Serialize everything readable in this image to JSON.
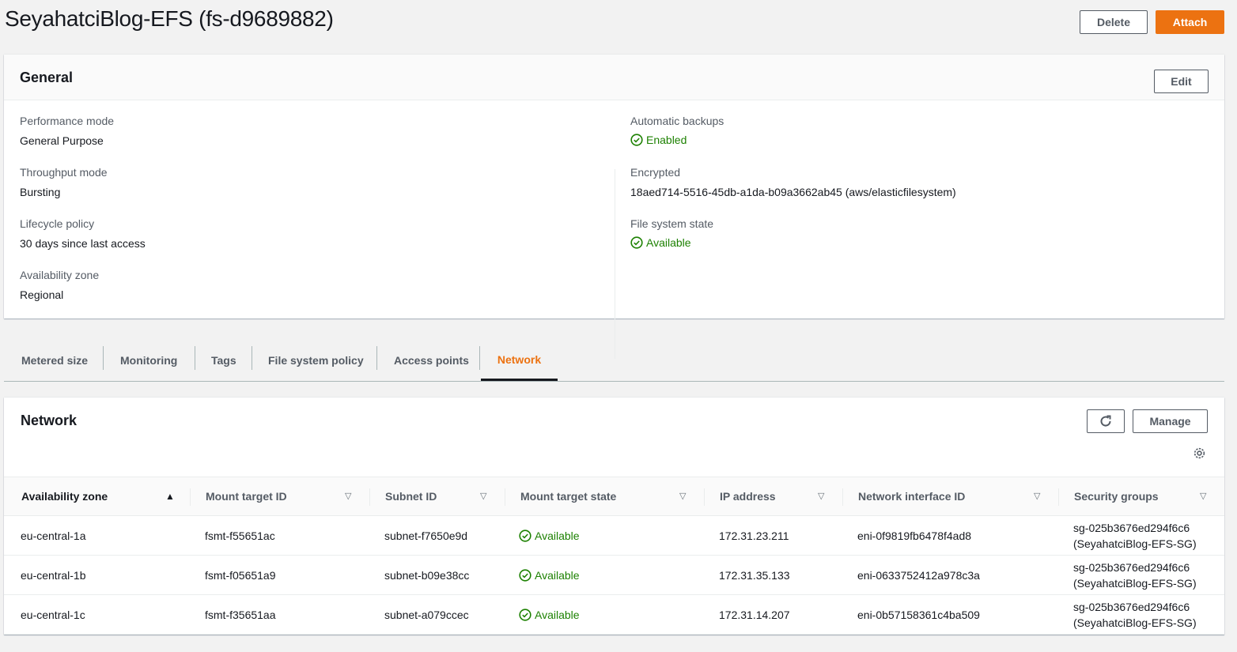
{
  "page": {
    "title": "SeyahatciBlog-EFS (fs-d9689882)",
    "delete_label": "Delete",
    "attach_label": "Attach"
  },
  "general": {
    "title": "General",
    "edit_label": "Edit",
    "left": [
      {
        "label": "Performance mode",
        "value": "General Purpose"
      },
      {
        "label": "Throughput mode",
        "value": "Bursting"
      },
      {
        "label": "Lifecycle policy",
        "value": "30 days since last access"
      },
      {
        "label": "Availability zone",
        "value": "Regional"
      }
    ],
    "right": [
      {
        "label": "Automatic backups",
        "value": "Enabled"
      },
      {
        "label": "Encrypted",
        "value": "18aed714-5516-45db-a1da-b09a3662ab45 (aws/elasticfilesystem)"
      },
      {
        "label": "File system state",
        "value": "Available"
      }
    ]
  },
  "tabs": [
    "Metered size",
    "Monitoring",
    "Tags",
    "File system policy",
    "Access points",
    "Network"
  ],
  "active_tab": "Network",
  "network": {
    "title": "Network",
    "manage_label": "Manage",
    "columns": [
      "Availability zone",
      "Mount target ID",
      "Subnet ID",
      "Mount target state",
      "IP address",
      "Network interface ID",
      "Security groups"
    ],
    "rows": [
      {
        "az": "eu-central-1a",
        "mt": "fsmt-f55651ac",
        "subnet": "subnet-f7650e9d",
        "state": "Available",
        "ip": "172.31.23.211",
        "eni": "eni-0f9819fb6478f4ad8",
        "sg": "sg-025b3676ed294f6c6",
        "sg_name": "(SeyahatciBlog-EFS-SG)"
      },
      {
        "az": "eu-central-1b",
        "mt": "fsmt-f05651a9",
        "subnet": "subnet-b09e38cc",
        "state": "Available",
        "ip": "172.31.35.133",
        "eni": "eni-0633752412a978c3a",
        "sg": "sg-025b3676ed294f6c6",
        "sg_name": "(SeyahatciBlog-EFS-SG)"
      },
      {
        "az": "eu-central-1c",
        "mt": "fsmt-f35651aa",
        "subnet": "subnet-a079ccec",
        "state": "Available",
        "ip": "172.31.14.207",
        "eni": "eni-0b57158361c4ba509",
        "sg": "sg-025b3676ed294f6c6",
        "sg_name": "(SeyahatciBlog-EFS-SG)"
      }
    ]
  },
  "colors": {
    "accent": "#ec7211",
    "success": "#1d8102"
  }
}
